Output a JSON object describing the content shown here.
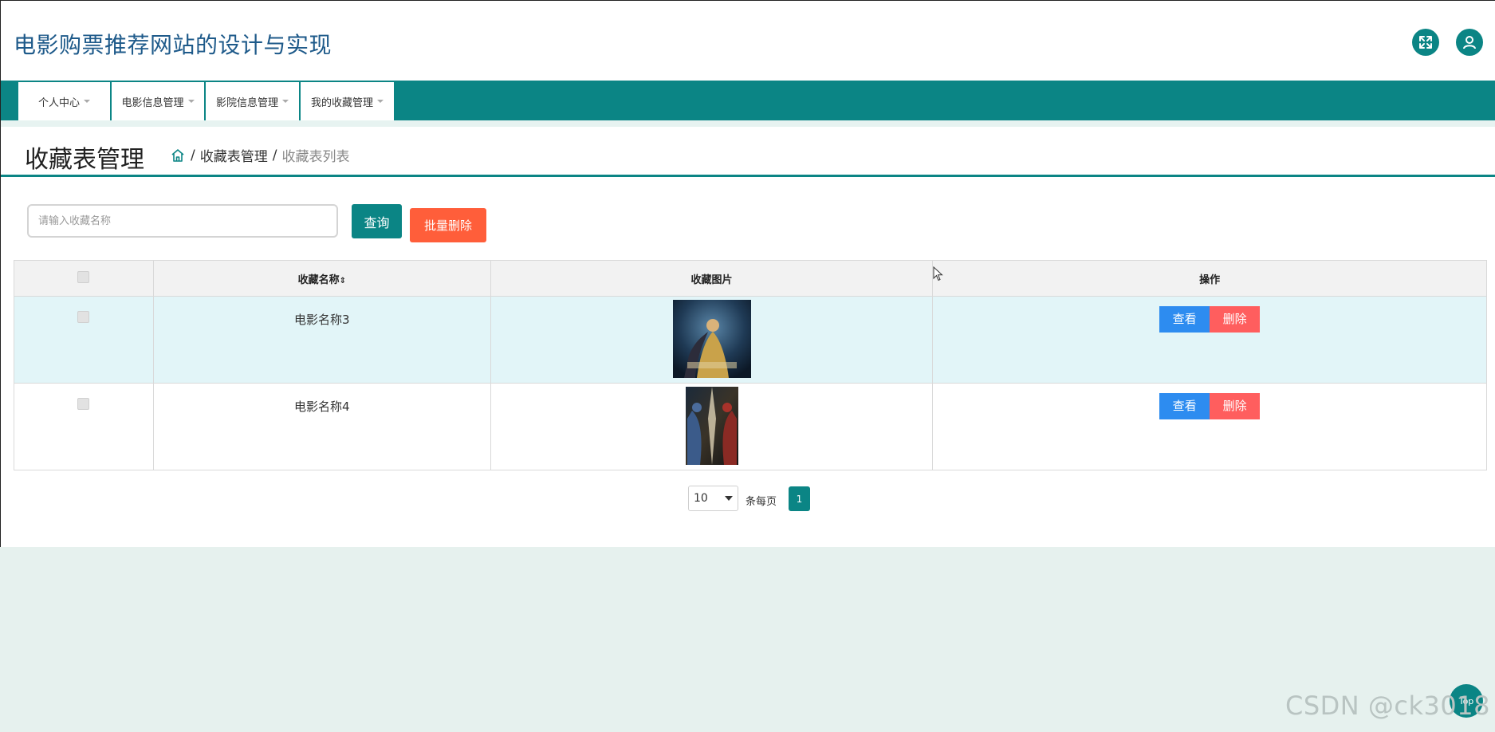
{
  "header": {
    "title": "电影购票推荐网站的设计与实现",
    "fullscreen_icon": "fullscreen-icon",
    "user_icon": "user-icon"
  },
  "nav": {
    "items": [
      {
        "label": "个人中心"
      },
      {
        "label": "电影信息管理"
      },
      {
        "label": "影院信息管理"
      },
      {
        "label": "我的收藏管理"
      }
    ]
  },
  "page": {
    "title": "收藏表管理",
    "breadcrumb": {
      "home_icon": "home-icon",
      "separator": "/",
      "section": "收藏表管理",
      "current": "收藏表列表"
    }
  },
  "search": {
    "placeholder": "请输入收藏名称",
    "value": "",
    "query_label": "查询",
    "batch_delete_label": "批量删除"
  },
  "table": {
    "columns": [
      "收藏名称",
      "收藏图片",
      "操作"
    ],
    "sort_icon": "⇕",
    "rows": [
      {
        "name": "电影名称3",
        "view_label": "查看",
        "delete_label": "删除"
      },
      {
        "name": "电影名称4",
        "view_label": "查看",
        "delete_label": "删除"
      }
    ]
  },
  "pagination": {
    "page_size": "10",
    "per_page_label": "条每页",
    "current_page": "1"
  },
  "back_to_top": "Top",
  "watermark": "CSDN @ck3018",
  "colors": {
    "primary": "#0b8585",
    "danger": "#ff5e3a",
    "info": "#2d8cf0",
    "row_highlight": "#e2f5f8"
  }
}
